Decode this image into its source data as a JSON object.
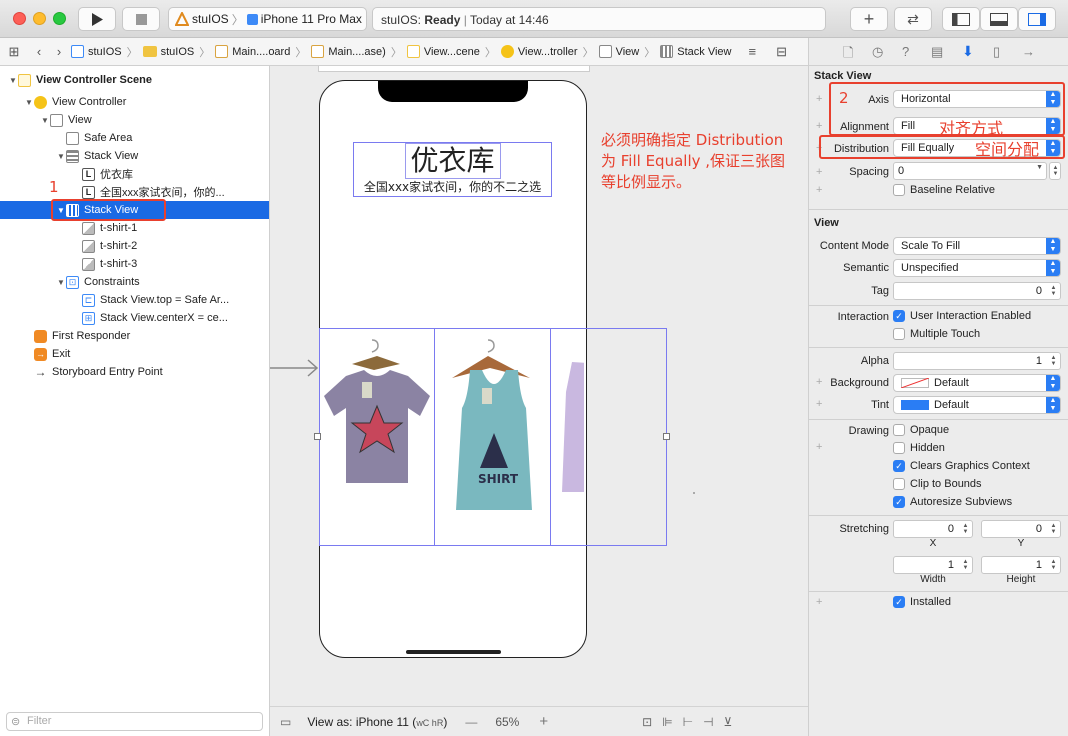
{
  "titlebar": {
    "scheme_app": "stuIOS",
    "scheme_device": "iPhone 11 Pro Max",
    "status_app": "stuIOS:",
    "status_state": "Ready",
    "status_time": "Today at 14:46"
  },
  "jumpbar": {
    "items": [
      "stuIOS",
      "stuIOS",
      "Main....oard",
      "Main....ase)",
      "View...cene",
      "View...troller",
      "View",
      "Stack View"
    ]
  },
  "navigator": {
    "rows": [
      {
        "label": "View Controller Scene",
        "bold": true
      },
      {
        "label": "View Controller"
      },
      {
        "label": "View"
      },
      {
        "label": "Safe Area"
      },
      {
        "label": "Stack View"
      },
      {
        "label": "优衣库"
      },
      {
        "label": "全国xxx家试衣间，你的..."
      },
      {
        "label": "Stack View",
        "selected": true
      },
      {
        "label": "t-shirt-1"
      },
      {
        "label": "t-shirt-2"
      },
      {
        "label": "t-shirt-3"
      },
      {
        "label": "Constraints"
      },
      {
        "label": "Stack View.top = Safe Ar..."
      },
      {
        "label": "Stack View.centerX = ce..."
      },
      {
        "label": "First Responder"
      },
      {
        "label": "Exit"
      },
      {
        "label": "Storyboard Entry Point"
      }
    ],
    "filter_placeholder": "Filter"
  },
  "canvas": {
    "title_label": "优衣库",
    "subtitle_label": "全国xxx家试衣间，你的不二之选",
    "annotation_1": "必须明确指定 Distribution",
    "annotation_2": "为 Fill Equally ,保证三张图",
    "annotation_3": "等比例显示。",
    "marker_1": "1",
    "marker_2": "2"
  },
  "bottombar": {
    "view_as": "View as: iPhone 11 (",
    "size_class": "wC hR",
    "view_as_close": ")",
    "zoom": "65%",
    "minus": "—",
    "plus": "+"
  },
  "inspector": {
    "stack_view_title": "Stack View",
    "axis_label": "Axis",
    "axis_value": "Horizontal",
    "alignment_label": "Alignment",
    "alignment_value": "Fill",
    "alignment_note": "对齐方式",
    "distribution_label": "Distribution",
    "distribution_value": "Fill Equally",
    "distribution_note": "空间分配",
    "spacing_label": "Spacing",
    "spacing_value": "0",
    "baseline_label": "Baseline Relative",
    "view_title": "View",
    "content_mode_label": "Content Mode",
    "content_mode_value": "Scale To Fill",
    "semantic_label": "Semantic",
    "semantic_value": "Unspecified",
    "tag_label": "Tag",
    "tag_value": "0",
    "interaction_label": "Interaction",
    "user_interaction_label": "User Interaction Enabled",
    "user_interaction_checked": true,
    "multiple_touch_label": "Multiple Touch",
    "alpha_label": "Alpha",
    "alpha_value": "1",
    "background_label": "Background",
    "background_value": "Default",
    "tint_label": "Tint",
    "tint_value": "Default",
    "drawing_label": "Drawing",
    "opaque_label": "Opaque",
    "hidden_label": "Hidden",
    "clears_label": "Clears Graphics Context",
    "clip_label": "Clip to Bounds",
    "autoresize_label": "Autoresize Subviews",
    "stretching_label": "Stretching",
    "stretch_x": "0",
    "stretch_y": "0",
    "stretch_w": "1",
    "stretch_h": "1",
    "x_label": "X",
    "y_label": "Y",
    "width_label": "Width",
    "height_label": "Height",
    "installed_label": "Installed"
  },
  "colors": {
    "accent": "#1a6ae4",
    "annotation_red": "#e8402e",
    "tint_blue": "#2a7df4"
  }
}
